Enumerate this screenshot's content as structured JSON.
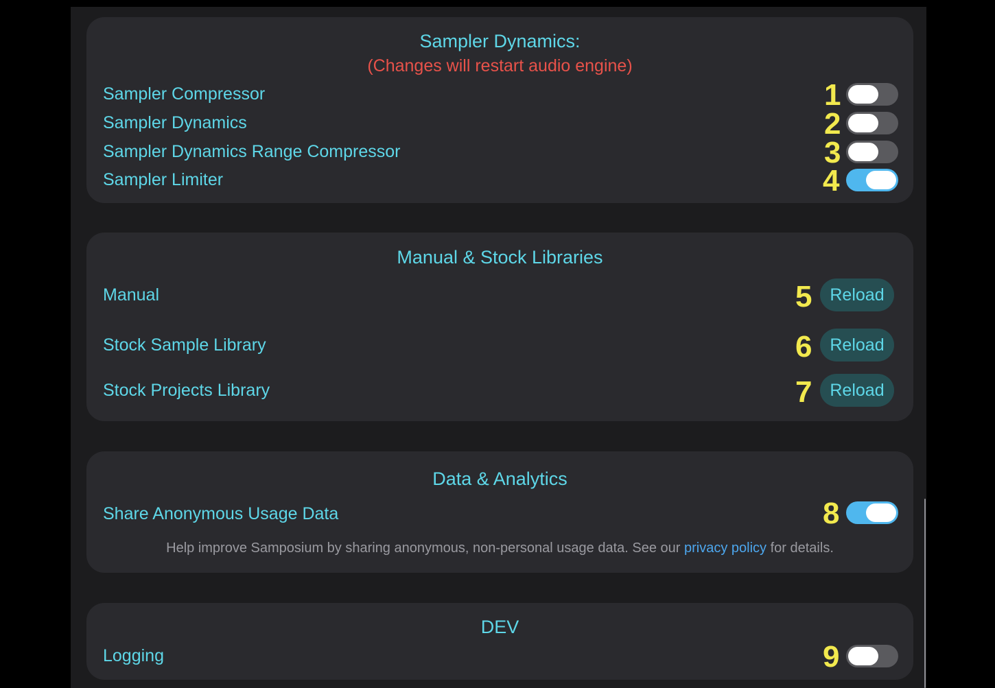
{
  "sampler_dynamics": {
    "title": "Sampler Dynamics:",
    "warning": "(Changes will restart audio engine)",
    "rows": [
      {
        "label": "Sampler Compressor",
        "on": false,
        "marker": "1"
      },
      {
        "label": "Sampler Dynamics",
        "on": false,
        "marker": "2"
      },
      {
        "label": "Sampler Dynamics Range Compressor",
        "on": false,
        "marker": "3"
      },
      {
        "label": "Sampler Limiter",
        "on": true,
        "marker": "4"
      }
    ]
  },
  "libraries": {
    "title": "Manual & Stock Libraries",
    "rows": [
      {
        "label": "Manual",
        "button": "Reload",
        "marker": "5"
      },
      {
        "label": "Stock Sample Library",
        "button": "Reload",
        "marker": "6"
      },
      {
        "label": "Stock Projects Library",
        "button": "Reload",
        "marker": "7"
      }
    ]
  },
  "analytics": {
    "title": "Data & Analytics",
    "row": {
      "label": "Share Anonymous Usage Data",
      "on": true,
      "marker": "8"
    },
    "note_prefix": "Help improve Samposium by sharing anonymous, non-personal usage data. See our ",
    "note_link": "privacy policy",
    "note_suffix": " for details."
  },
  "dev": {
    "title": "DEV",
    "row": {
      "label": "Logging",
      "on": false,
      "marker": "9"
    }
  },
  "colors": {
    "accent_text": "#5ed7e8",
    "warning": "#e8524a",
    "toggle_on": "#4fb7ee",
    "toggle_off": "#5a5a5e",
    "marker": "#f2e94e",
    "link": "#4da7ee"
  }
}
